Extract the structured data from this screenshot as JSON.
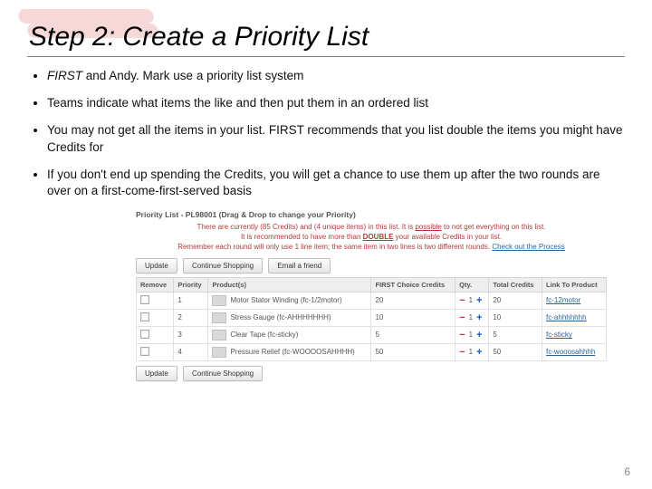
{
  "title": "Step 2: Create a Priority List",
  "bullets": [
    {
      "first": "FIRST",
      "rest": " and Andy. Mark use a priority list system"
    },
    {
      "first": "",
      "rest": "Teams indicate what items the like and then put them in an ordered list"
    },
    {
      "first": "",
      "rest": "You may not get all the items in your list. FIRST recommends that you list double the items you might have Credits for"
    },
    {
      "first": "",
      "rest": "If you don't end up spending the Credits, you will get a chance to use them up after the two rounds are over on a first-come-first-served basis"
    }
  ],
  "screenshot": {
    "header": "Priority List - PL98001 (Drag & Drop to change your Priority)",
    "warn": {
      "line1a": "There are currently (85 Credits) and (4 unique items) in this list. It is ",
      "line1b": "possible",
      "line1c": " to not get everything on this list.",
      "line2a": "It is recommended to have more than ",
      "double": "DOUBLE",
      "line2b": " your available Credits in your list.",
      "line3a": "Remember each round will only use 1 line item; the same item in two lines is two different rounds. ",
      "checkout": "Check out the Process"
    },
    "buttons": {
      "update": "Update",
      "continue": "Continue Shopping",
      "email": "Email a friend"
    },
    "columns": {
      "remove": "Remove",
      "priority": "Priority",
      "product": "Product(s)",
      "first_credits": "FIRST Choice Credits",
      "qty": "Qty.",
      "total_credits": "Total Credits",
      "link": "Link To Product"
    },
    "rows": [
      {
        "priority": "1",
        "product": "Motor Stator Winding (fc-1/2motor)",
        "credits": "20",
        "qty": "1",
        "total": "20",
        "link": "fc-12motor"
      },
      {
        "priority": "2",
        "product": "Stress Gauge (fc-AHHHHHHH)",
        "credits": "10",
        "qty": "1",
        "total": "10",
        "link": "fc-ahhhhhhh"
      },
      {
        "priority": "3",
        "product": "Clear Tape (fc-sticky)",
        "credits": "5",
        "qty": "1",
        "total": "5",
        "link": "fc-sticky"
      },
      {
        "priority": "4",
        "product": "Pressure Relief (fc-WOOOOSAHHHH)",
        "credits": "50",
        "qty": "1",
        "total": "50",
        "link": "fc-wooosahhhh"
      }
    ]
  },
  "page_number": "6"
}
